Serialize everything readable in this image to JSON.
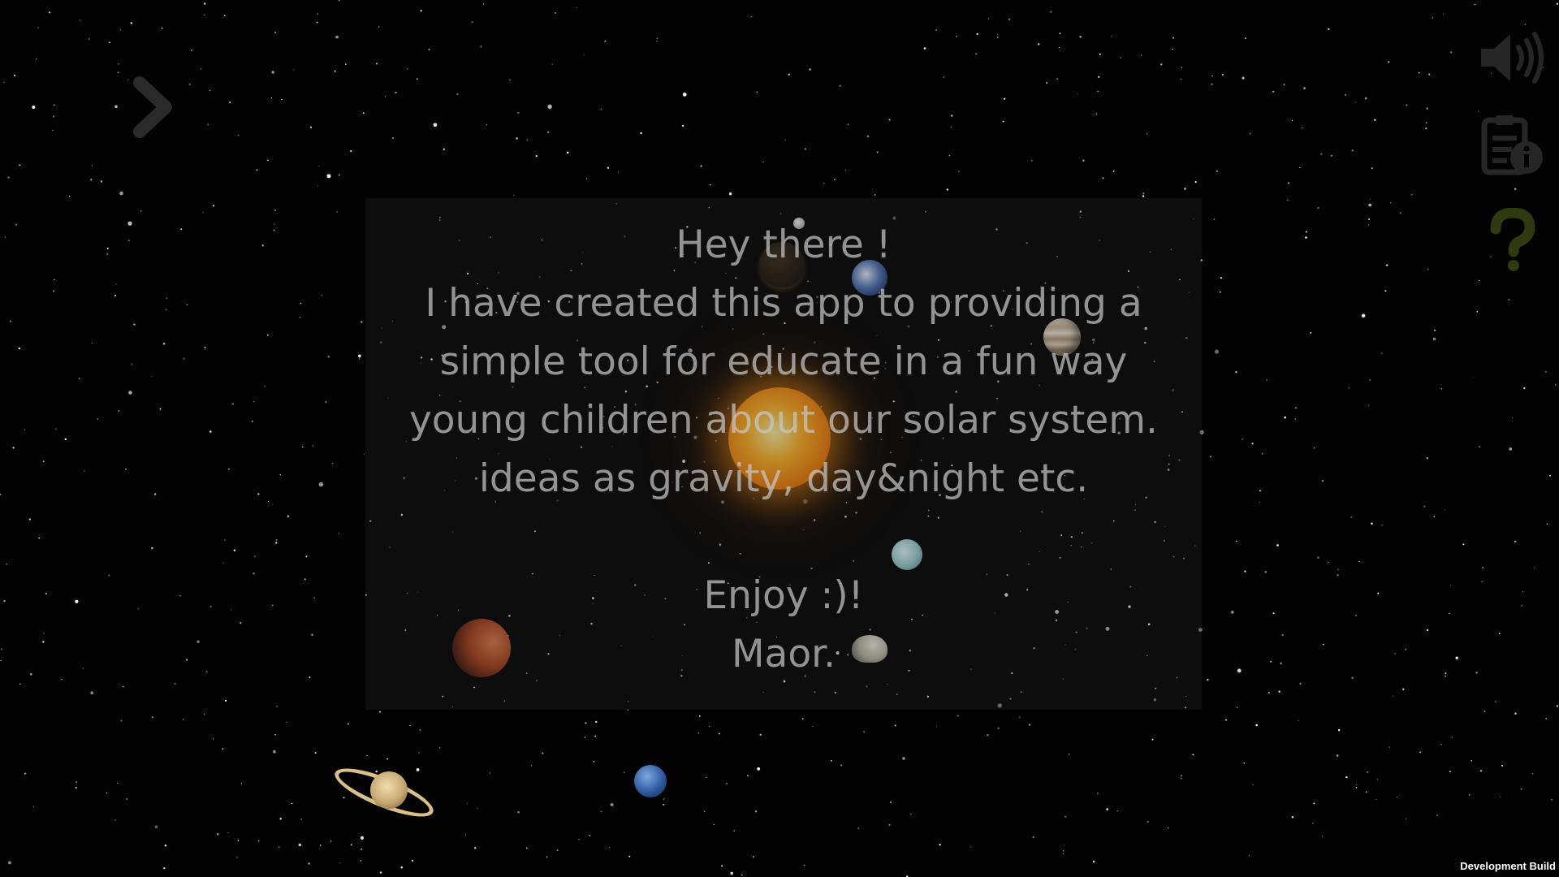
{
  "message": {
    "lines": [
      "Hey there !",
      "I have created this app to providing a",
      "simple tool for educate in a fun way",
      "young children about our solar system.",
      "ideas as gravity, day&night etc.",
      "",
      "Enjoy :)!",
      "Maor."
    ]
  },
  "toolbar": {
    "next_icon": "chevron-right-icon",
    "sound_icon": "speaker-volume-icon",
    "info_icon": "clipboard-info-icon",
    "help_icon": "question-mark-icon"
  },
  "footer": {
    "build_label": "Development Build"
  },
  "colors": {
    "background": "#000000",
    "message_text": "#c8c8c8",
    "ui_icon": "#2a2a2a",
    "help_icon": "#2f3a10",
    "sun": "#f59a10"
  }
}
